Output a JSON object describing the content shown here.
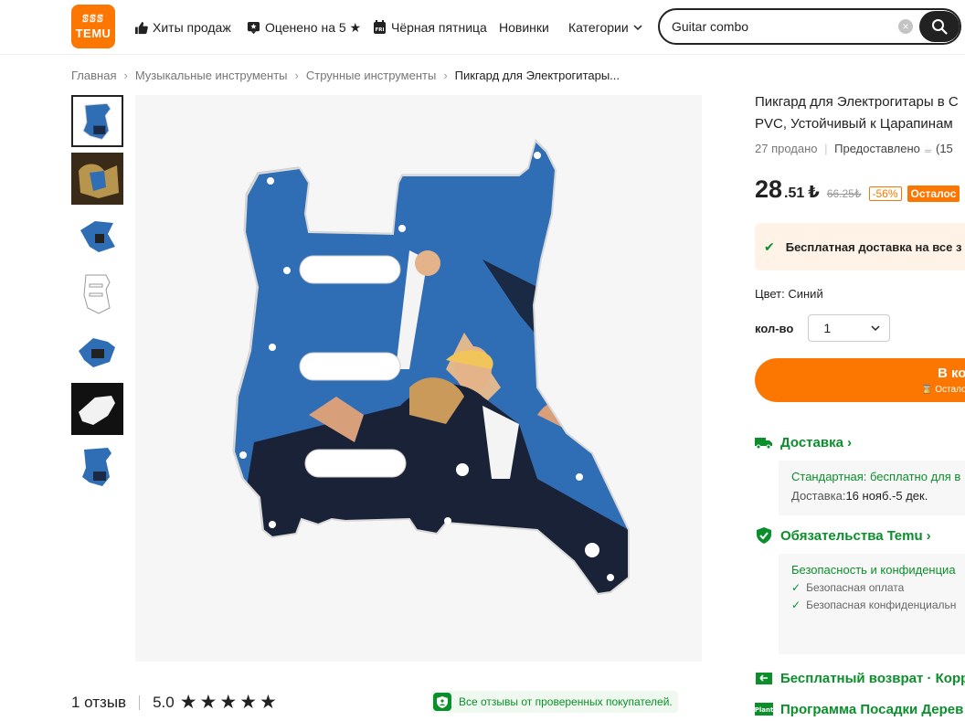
{
  "header": {
    "logo_glyphs": "ꕷꕷꕷ",
    "logo_text": "TEMU",
    "nav": [
      {
        "label": "Хиты продаж"
      },
      {
        "label": "Оценено на 5 ★"
      },
      {
        "label": "Чёрная пятница"
      },
      {
        "label": "Новинки"
      },
      {
        "label": "Категории"
      }
    ],
    "search": {
      "value": "Guitar combo"
    }
  },
  "breadcrumb": [
    "Главная",
    "Музыкальные инструменты",
    "Струнные инструменты",
    "Пикгард для Электрогитары..."
  ],
  "thumbnails": [
    {
      "name": "thumb-1"
    },
    {
      "name": "thumb-2"
    },
    {
      "name": "thumb-3"
    },
    {
      "name": "thumb-4"
    },
    {
      "name": "thumb-5"
    },
    {
      "name": "thumb-6"
    },
    {
      "name": "thumb-7"
    }
  ],
  "product": {
    "title_line1": "Пикгард для Электрогитары в С",
    "title_line2": "PVC, Устойчивый к Царапинам",
    "sold": "27 продано",
    "provided_by": "Предоставлено",
    "provider_count": "(15",
    "price_int": "28",
    "price_cents": ".51",
    "currency": "₺",
    "price_old": "66.25₺",
    "discount": "-56%",
    "stock_badge": "Осталос",
    "free_shipping": "Бесплатная доставка на все з",
    "color_label": "Цвет: Синий",
    "qty_label": "кол-во",
    "qty_value": "1",
    "buy_label": "В ко",
    "buy_sub": "Остало"
  },
  "delivery": {
    "title": "Доставка",
    "standard": "Стандартная: бесплатно для в",
    "eta_label": "Доставка:",
    "eta_value": "16 нояб.-5 дек."
  },
  "commitment": {
    "title": "Обязательства Temu",
    "privacy": "Безопасность и конфиденциа",
    "items": [
      "Безопасная оплата",
      "Безопасная конфиденциальн"
    ]
  },
  "returns": {
    "title": "Бесплатный возврат · Корр"
  },
  "plant": {
    "title": "Программа Посадки Дерев",
    "icon_text": "Plant"
  },
  "reviews": {
    "count": "1 отзыв",
    "rating": "5.0",
    "stars": "★★★★★",
    "verified": "Все отзывы от проверенных покупателей."
  },
  "colors": {
    "brand": "#fb7701",
    "green": "#0a8f2b",
    "pickguard_blue": "#2f6db5"
  }
}
